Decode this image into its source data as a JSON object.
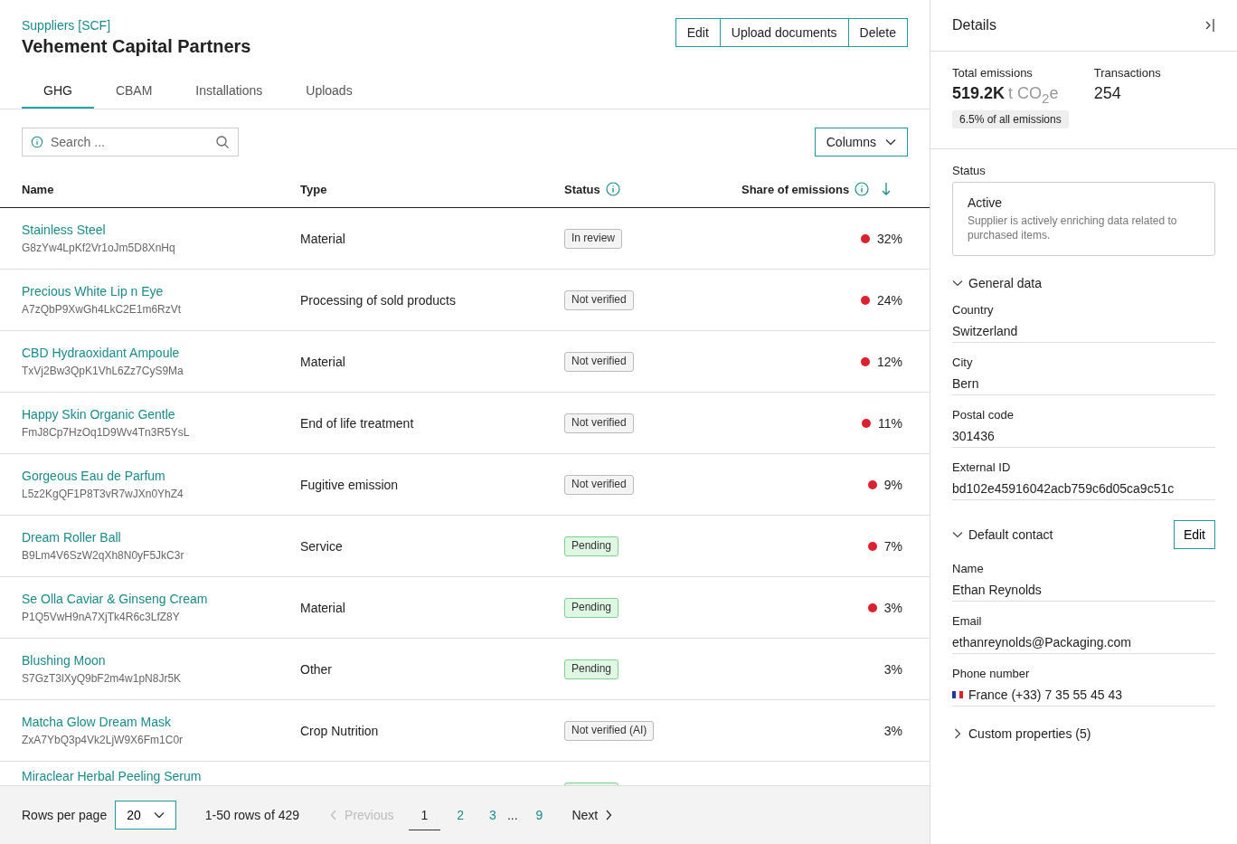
{
  "breadcrumb": "Suppliers [SCF]",
  "title": "Vehement Capital Partners",
  "actions": [
    "Edit",
    "Upload documents",
    "Delete"
  ],
  "tabs": [
    {
      "label": "GHG",
      "selected": true
    },
    {
      "label": "CBAM",
      "selected": false
    },
    {
      "label": "Installations",
      "selected": false
    },
    {
      "label": "Uploads",
      "selected": false
    }
  ],
  "search": {
    "placeholder": "Search ..."
  },
  "columns_button": "Columns",
  "table": {
    "columns": [
      {
        "label": "Name"
      },
      {
        "label": "Type"
      },
      {
        "label": "Status",
        "info": true
      },
      {
        "label": "Share of emissions",
        "info": true,
        "sorted": true
      }
    ],
    "rows": [
      {
        "name": "Stainless Steel",
        "code": "G8zYw4LpKf2Vr1oJm5D8XnHq",
        "type": "Material",
        "status": {
          "label": "In review",
          "kind": "neutral"
        },
        "flagged": true,
        "share": "32%"
      },
      {
        "name": "Precious White Lip n Eye",
        "code": "A7zQbP9XwGh4LkC2E1m6RzVt",
        "type": "Processing of sold products",
        "status": {
          "label": "Not verified",
          "kind": "neutral"
        },
        "flagged": true,
        "share": "24%"
      },
      {
        "name": "CBD Hydraoxidant Ampoule",
        "code": "TxVj2Bw3QpK1VhL6Zz7CyS9Ma",
        "type": "Material",
        "status": {
          "label": "Not verified",
          "kind": "neutral"
        },
        "flagged": true,
        "share": "12%"
      },
      {
        "name": "Happy Skin Organic Gentle",
        "code": "FmJ8Cp7HzOq1D9Wv4Tn3R5YsL",
        "type": "End of life treatment",
        "status": {
          "label": "Not verified",
          "kind": "neutral"
        },
        "flagged": true,
        "share": "11%"
      },
      {
        "name": "Gorgeous Eau de Parfum",
        "code": "L5z2KgQF1P8T3vR7wJXn0YhZ4",
        "type": "Fugitive emission",
        "status": {
          "label": "Not verified",
          "kind": "neutral"
        },
        "flagged": true,
        "share": "9%"
      },
      {
        "name": "Dream Roller Ball",
        "code": "B9Lm4V6SzW2qXh8N0yF5JkC3r",
        "type": "Service",
        "status": {
          "label": "Pending",
          "kind": "pending"
        },
        "flagged": true,
        "share": "7%"
      },
      {
        "name": "Se Olla Caviar & Ginseng Cream",
        "code": "P1Q5VwH9nA7XjTk4R6c3LfZ8Y",
        "type": "Material",
        "status": {
          "label": "Pending",
          "kind": "pending"
        },
        "flagged": true,
        "share": "3%"
      },
      {
        "name": "Blushing Moon",
        "code": "S7GzT3lXyQ9bF2m4w1pN8Jr5K",
        "type": "Other",
        "status": {
          "label": "Pending",
          "kind": "pending"
        },
        "flagged": false,
        "share": "3%"
      },
      {
        "name": "Matcha Glow Dream Mask",
        "code": "ZxA7YbQ3p4Vk2LjW9X6Fm1C0r",
        "type": "Crop Nutrition",
        "status": {
          "label": "Not verified (AI)",
          "kind": "neutral"
        },
        "flagged": false,
        "share": "3%"
      },
      {
        "name": "Miraclear Herbal Peeling Serum",
        "status": {
          "kind": "pending"
        }
      }
    ]
  },
  "pagination": {
    "rows_per_page_label": "Rows per page",
    "rows_per_page": "20",
    "range": "1-50 rows of 429",
    "previous": {
      "label": "Previous",
      "disabled": true
    },
    "pages": [
      {
        "label": "1",
        "selected": true
      },
      {
        "label": "2",
        "selected": false
      },
      {
        "label": "3",
        "selected": false
      },
      {
        "label": "...",
        "kind": "gap"
      },
      {
        "label": "9",
        "selected": false
      }
    ],
    "next": {
      "label": "Next",
      "disabled": false
    }
  },
  "details": {
    "title": "Details",
    "total_label": "Total emissions",
    "total_value": "519.2K",
    "total_unit": "t CO$_{2}$e",
    "share_badge": "6.5% of all emissions",
    "transactions_label": "Transactions",
    "transactions_value": "254",
    "status_label": "Status",
    "status_title": "Active",
    "status_text": "Supplier is actively enriching data related to purchased items.",
    "sections": [
      {
        "title": "General data",
        "expanded": true,
        "fields": [
          {
            "label": "Country",
            "value": "Switzerland"
          },
          {
            "label": "City",
            "value": "Bern"
          },
          {
            "label": "Postal code",
            "value": "301436"
          },
          {
            "label": "External ID",
            "value": "bd102e45916042acb759c6d05ca9c51c"
          }
        ]
      },
      {
        "title": "Default contact",
        "expanded": true,
        "edit": "Edit",
        "fields": [
          {
            "label": "Name",
            "value": "Ethan Reynolds"
          },
          {
            "label": "Email",
            "value": "ethanreynolds@Packaging.com"
          },
          {
            "label": "Phone number",
            "value": "France (+33) 7 35 55 45 43",
            "flag": true
          }
        ]
      },
      {
        "title": "Custom properties (5)",
        "expanded": false
      }
    ]
  }
}
